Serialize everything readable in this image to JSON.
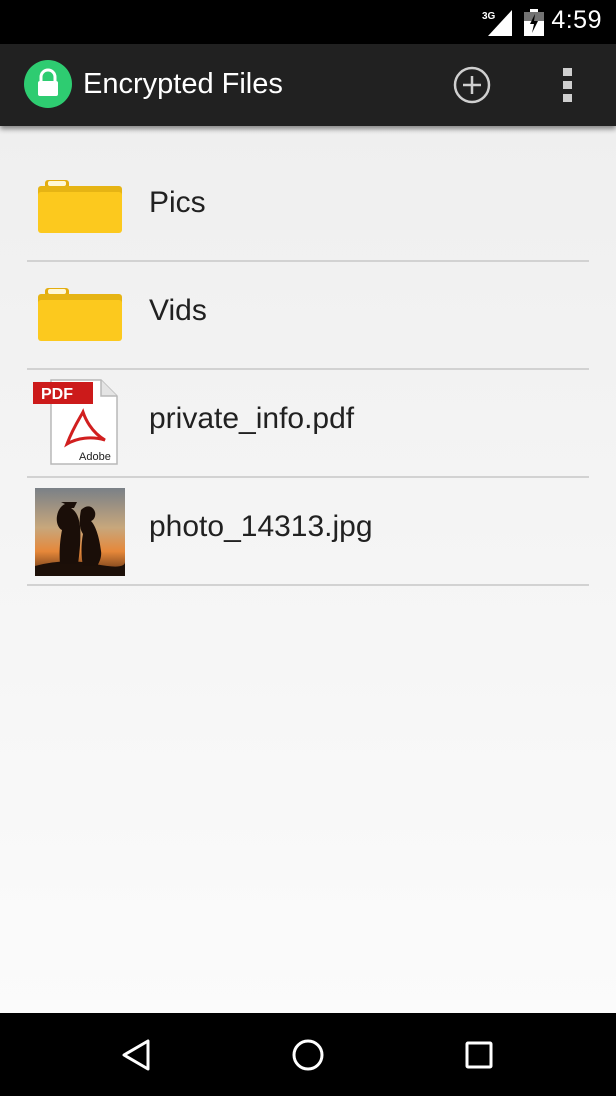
{
  "status_bar": {
    "network": "3G",
    "time": "4:59",
    "icons": [
      "signal-icon",
      "battery-icon"
    ]
  },
  "action_bar": {
    "title": "Encrypted Files",
    "icons": [
      "lock-icon",
      "add-circle-icon",
      "overflow-menu-icon"
    ]
  },
  "files": [
    {
      "name": "Pics",
      "type": "folder",
      "icon": "folder-icon"
    },
    {
      "name": "Vids",
      "type": "folder",
      "icon": "folder-icon"
    },
    {
      "name": "private_info.pdf",
      "type": "pdf",
      "icon": "pdf-icon",
      "badge": "PDF",
      "brand": "Adobe"
    },
    {
      "name": "photo_14313.jpg",
      "type": "image",
      "icon": "photo-thumbnail"
    }
  ],
  "nav_bar": {
    "icons": [
      "back-icon",
      "home-icon",
      "recent-apps-icon"
    ]
  },
  "colors": {
    "status_bar": "#000000",
    "action_bar": "#212121",
    "app_logo": "#2ecc71",
    "folder": "#fcc91e",
    "pdf_badge": "#cc1a1a",
    "divider": "#d2d2d2"
  }
}
